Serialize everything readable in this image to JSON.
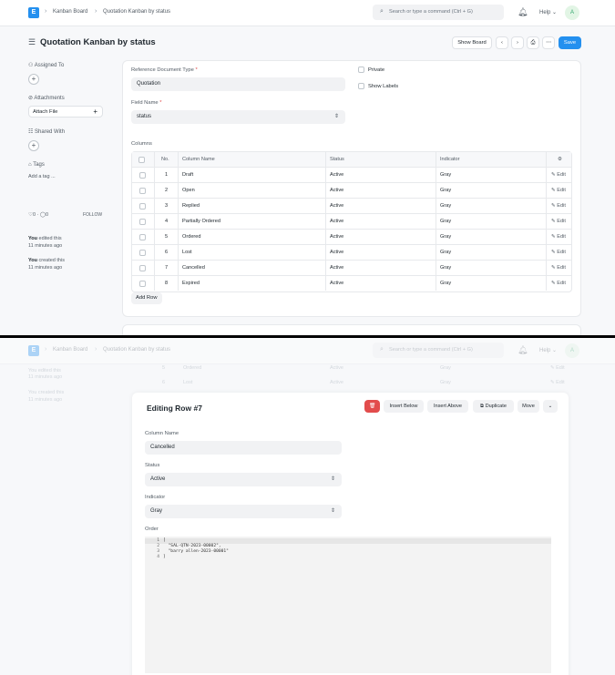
{
  "nav": {
    "logo": "E",
    "crumb1": "Kanban Board",
    "crumb2": "Quotation Kanban by status",
    "search_placeholder": "Search or type a command (Ctrl + G)",
    "help": "Help",
    "avatar": "A"
  },
  "page": {
    "title": "Quotation Kanban by status",
    "show_board": "Show Board",
    "save": "Save"
  },
  "sidebar": {
    "assigned_to": "Assigned To",
    "attachments": "Attachments",
    "attach_file": "Attach File",
    "shared_with": "Shared With",
    "tags": "Tags",
    "add_tag": "Add a tag ...",
    "likes": "0",
    "comments": "0",
    "follow": "FOLLOW",
    "edited_by": "You",
    "edited_text": "edited this",
    "edited_time": "11 minutes ago",
    "created_by": "You",
    "created_text": "created this",
    "created_time": "11 minutes ago"
  },
  "form": {
    "ref_doc_label": "Reference Document Type",
    "ref_doc_value": "Quotation",
    "private_label": "Private",
    "show_labels_label": "Show Labels",
    "field_name_label": "Field Name",
    "field_name_value": "status",
    "columns_label": "Columns",
    "add_row": "Add Row"
  },
  "table": {
    "headers": [
      "No.",
      "Column Name",
      "Status",
      "Indicator"
    ],
    "edit_label": "Edit",
    "rows": [
      {
        "no": "1",
        "name": "Draft",
        "status": "Active",
        "indicator": "Gray"
      },
      {
        "no": "2",
        "name": "Open",
        "status": "Active",
        "indicator": "Gray"
      },
      {
        "no": "3",
        "name": "Replied",
        "status": "Active",
        "indicator": "Gray"
      },
      {
        "no": "4",
        "name": "Partially Ordered",
        "status": "Active",
        "indicator": "Gray"
      },
      {
        "no": "5",
        "name": "Ordered",
        "status": "Active",
        "indicator": "Gray"
      },
      {
        "no": "6",
        "name": "Lost",
        "status": "Active",
        "indicator": "Gray"
      },
      {
        "no": "7",
        "name": "Cancelled",
        "status": "Active",
        "indicator": "Gray"
      },
      {
        "no": "8",
        "name": "Expired",
        "status": "Active",
        "indicator": "Gray"
      }
    ]
  },
  "editor": {
    "title": "Editing Row #7",
    "insert_below": "Insert Below",
    "insert_above": "Insert Above",
    "duplicate": "Duplicate",
    "move": "Move",
    "column_name_label": "Column Name",
    "column_name_value": "Cancelled",
    "status_label": "Status",
    "status_value": "Active",
    "indicator_label": "Indicator",
    "indicator_value": "Gray",
    "order_label": "Order",
    "code_lines": [
      "[",
      "  \"SAL-QTN-2023-00002\",",
      "  \"barry allen-2023-00001\"",
      "]"
    ],
    "line_numbers": [
      "1",
      "2",
      "3",
      "4"
    ]
  },
  "background_rows": {
    "row5_no": "5",
    "row5_name": "Ordered",
    "row5_status": "Active",
    "row5_ind": "Gray",
    "row6_no": "6",
    "row6_name": "Lost",
    "row6_status": "Active",
    "row6_ind": "Gray"
  },
  "colors": {
    "primary": "#2490ef",
    "danger": "#e24c4c",
    "background": "#f7f8fa"
  }
}
